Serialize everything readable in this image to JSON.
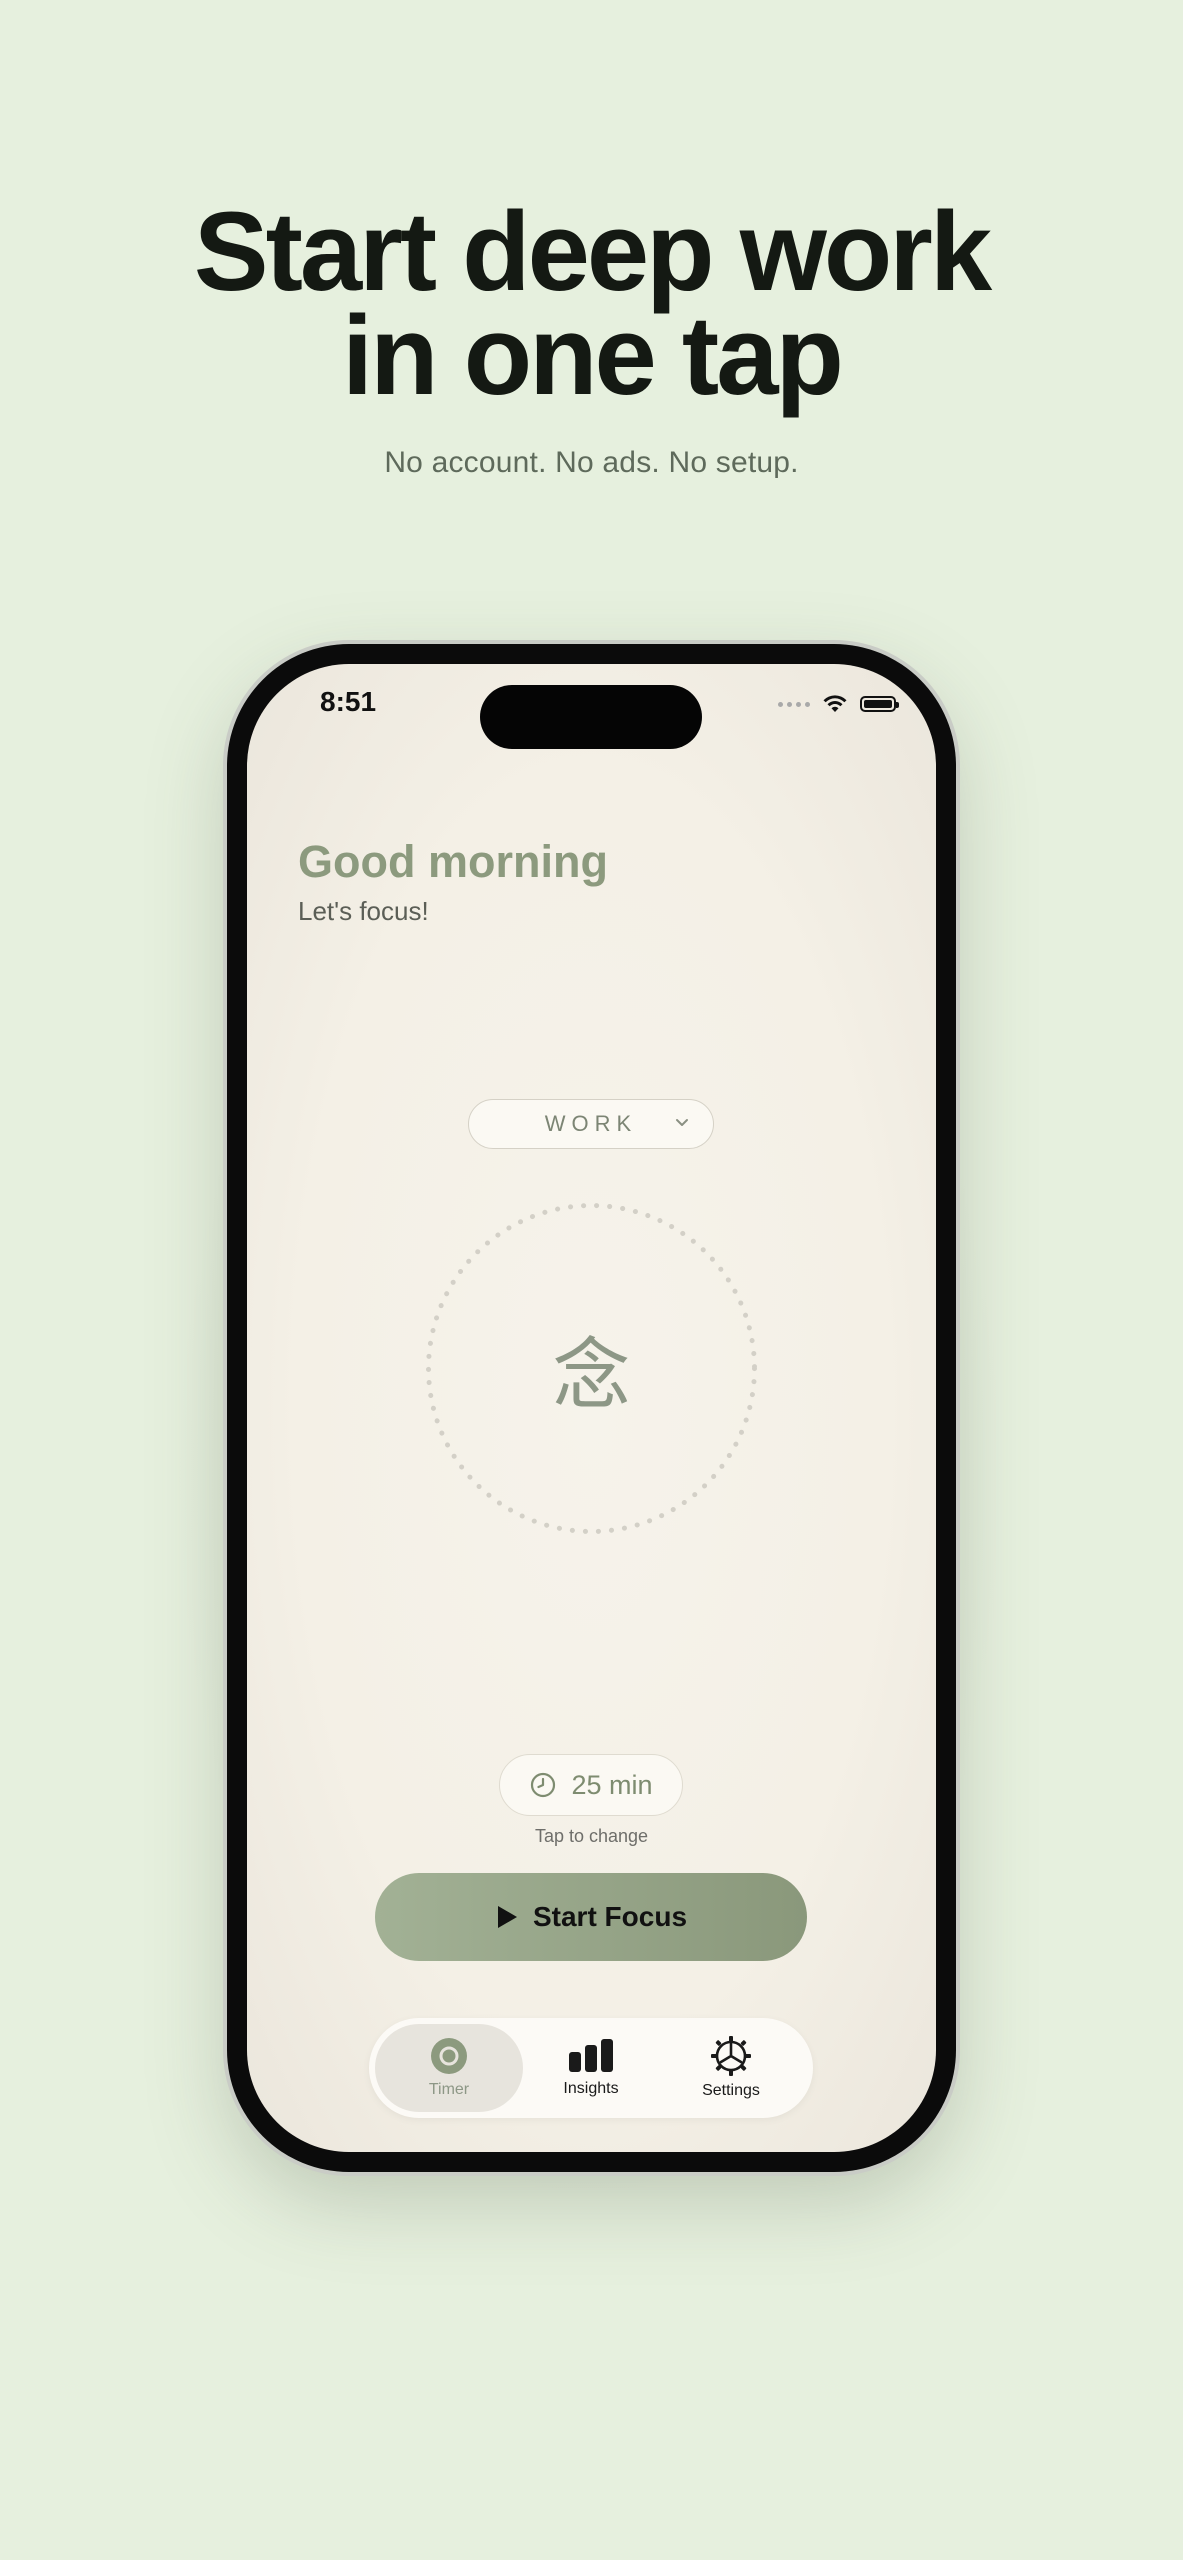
{
  "headline": {
    "line1": "Start deep work",
    "line2": "in one tap",
    "subtitle": "No account. No ads. No setup."
  },
  "status_bar": {
    "time": "8:51",
    "icons": [
      "signal-dots-icon",
      "wifi-icon",
      "battery-icon"
    ]
  },
  "home": {
    "greeting": "Good morning",
    "subtitle": "Let's focus!",
    "mode": {
      "selected": "WORK",
      "icon": "chevron-down-icon"
    },
    "focus_symbol": "念",
    "duration": {
      "value": "25 min",
      "icon": "clock-icon",
      "hint": "Tap to change"
    },
    "start_button": {
      "label": "Start Focus",
      "icon": "play-icon"
    }
  },
  "tab_bar": {
    "items": [
      {
        "label": "Timer",
        "icon": "timer-icon",
        "active": true
      },
      {
        "label": "Insights",
        "icon": "bar-chart-icon",
        "active": false
      },
      {
        "label": "Settings",
        "icon": "gear-icon",
        "active": false
      }
    ]
  },
  "colors": {
    "background": "#e6f0de",
    "accent": "#8c9a7e",
    "headline": "#141913"
  }
}
